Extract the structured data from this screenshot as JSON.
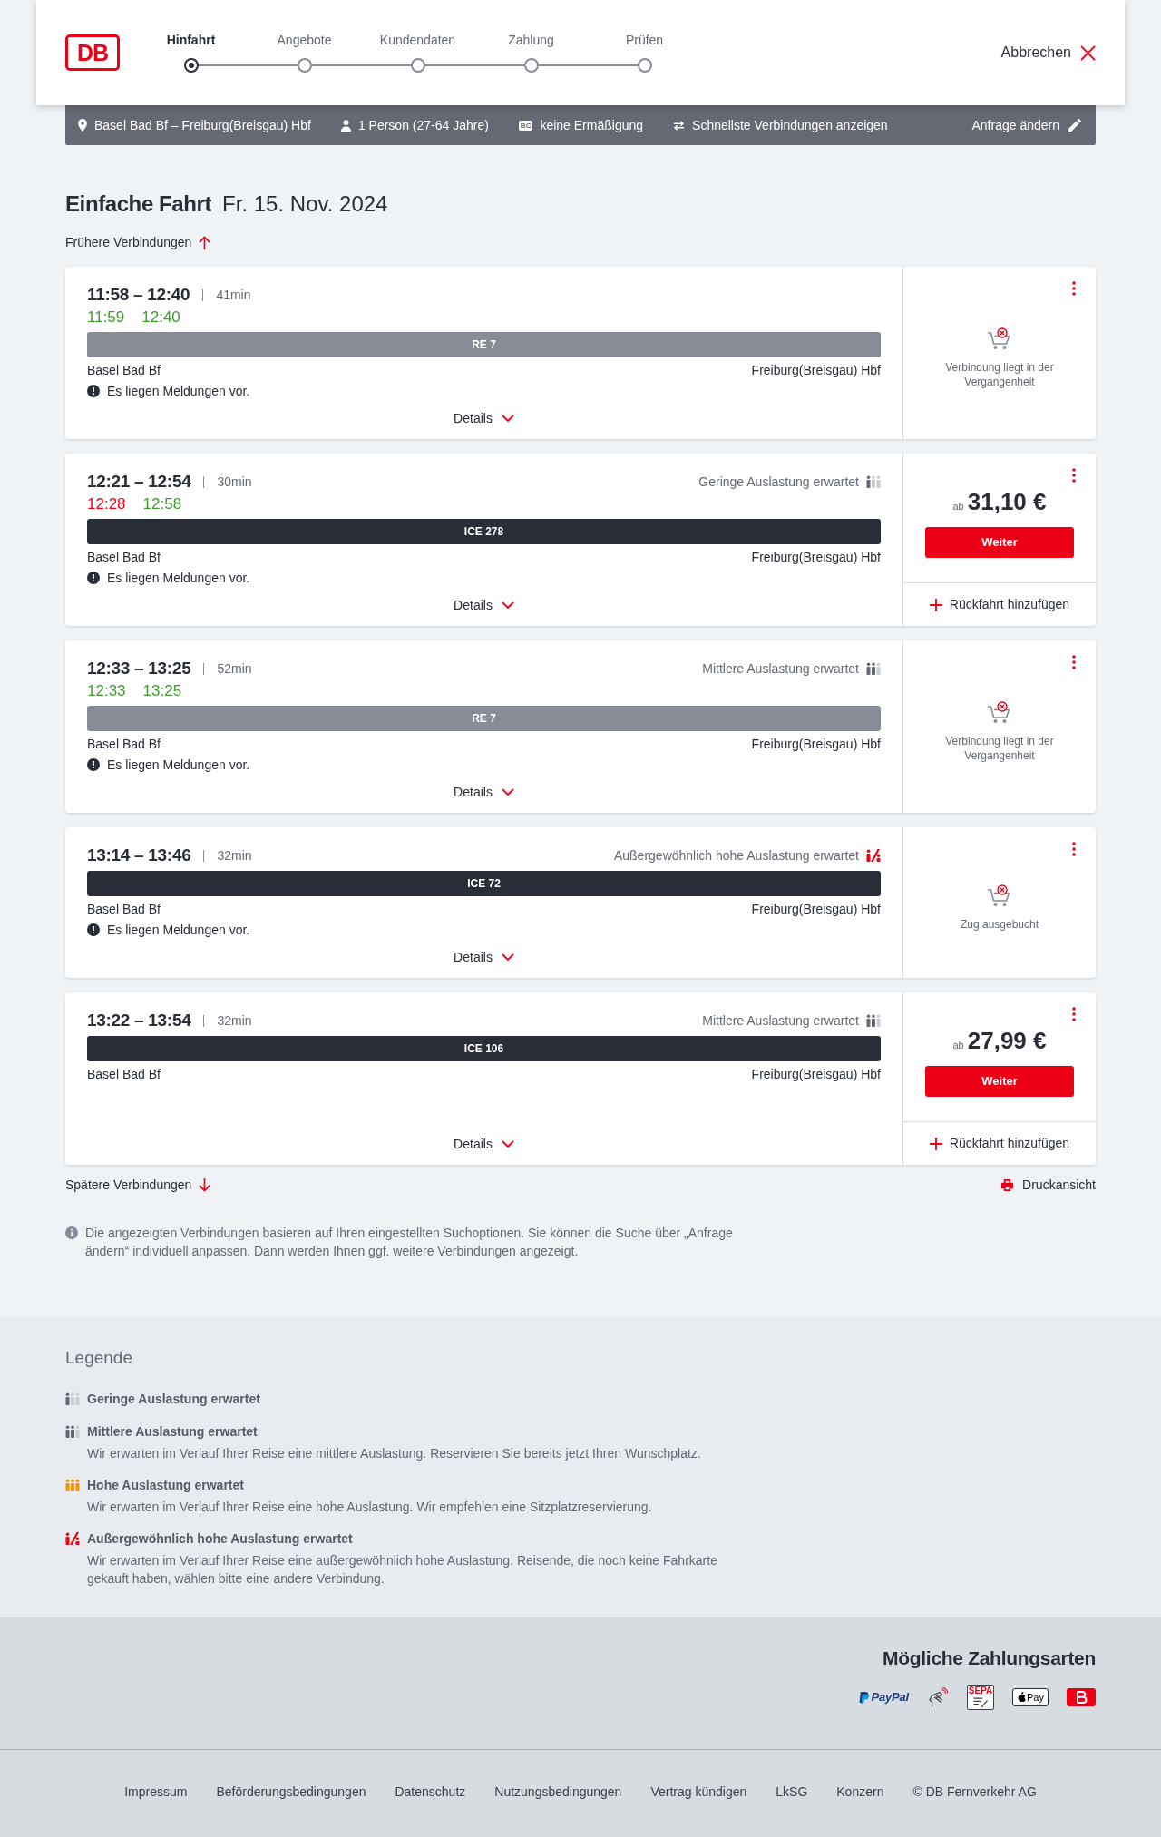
{
  "header": {
    "logo": "DB",
    "steps": [
      {
        "label": "Hinfahrt",
        "selected": true
      },
      {
        "label": "Angebote",
        "selected": false
      },
      {
        "label": "Kundendaten",
        "selected": false
      },
      {
        "label": "Zahlung",
        "selected": false
      },
      {
        "label": "Prüfen",
        "selected": false
      }
    ],
    "cancel": "Abbrechen"
  },
  "search_summary": {
    "route": "Basel Bad Bf – Freiburg(Breisgau) Hbf",
    "travellers": "1 Person (27-64 Jahre)",
    "card_badge": "BC",
    "discount": "keine Ermäßigung",
    "option": "Schnellste Verbindungen anzeigen",
    "edit": "Anfrage ändern"
  },
  "heading": {
    "trip_type": "Einfache Fahrt",
    "date": "Fr. 15. Nov. 2024"
  },
  "earlier": "Frühere Verbindungen",
  "connections": [
    {
      "times": "11:58 – 12:40",
      "duration": "41min",
      "realtime": [
        {
          "time": "11:59",
          "delayed": false
        },
        {
          "time": "12:40",
          "delayed": false
        }
      ],
      "train": {
        "name": "RE 7",
        "kind": "regional"
      },
      "from": "Basel Bad Bf",
      "to": "Freiburg(Breisgau) Hbf",
      "notice": "Es liegen Meldungen vor.",
      "details": "Details",
      "offer": {
        "kind": "unavailable",
        "message": "Verbindung liegt in der Vergangenheit"
      }
    },
    {
      "times": "12:21 – 12:54",
      "duration": "30min",
      "occupancy": {
        "kind": "low",
        "label": "Geringe Auslastung erwartet"
      },
      "realtime": [
        {
          "time": "12:28",
          "delayed": true
        },
        {
          "time": "12:58",
          "delayed": false
        }
      ],
      "train": {
        "name": "ICE 278",
        "kind": "intercity"
      },
      "from": "Basel Bad Bf",
      "to": "Freiburg(Breisgau) Hbf",
      "notice": "Es liegen Meldungen vor.",
      "details": "Details",
      "offer": {
        "kind": "price",
        "prefix": "ab",
        "price": "31,10 €",
        "button": "Weiter",
        "return_trip": "Rückfahrt hinzufügen"
      }
    },
    {
      "times": "12:33 – 13:25",
      "duration": "52min",
      "occupancy": {
        "kind": "medium",
        "label": "Mittlere Auslastung erwartet"
      },
      "realtime": [
        {
          "time": "12:33",
          "delayed": false
        },
        {
          "time": "13:25",
          "delayed": false
        }
      ],
      "train": {
        "name": "RE 7",
        "kind": "regional"
      },
      "from": "Basel Bad Bf",
      "to": "Freiburg(Breisgau) Hbf",
      "notice": "Es liegen Meldungen vor.",
      "details": "Details",
      "offer": {
        "kind": "unavailable",
        "message": "Verbindung liegt in der Vergangenheit"
      }
    },
    {
      "times": "13:14 – 13:46",
      "duration": "32min",
      "occupancy": {
        "kind": "exceptional",
        "label": "Außergewöhnlich hohe Auslastung erwartet"
      },
      "train": {
        "name": "ICE 72",
        "kind": "intercity"
      },
      "from": "Basel Bad Bf",
      "to": "Freiburg(Breisgau) Hbf",
      "notice": "Es liegen Meldungen vor.",
      "details": "Details",
      "offer": {
        "kind": "unavailable",
        "message": "Zug ausgebucht"
      }
    },
    {
      "times": "13:22 – 13:54",
      "duration": "32min",
      "occupancy": {
        "kind": "medium",
        "label": "Mittlere Auslastung erwartet"
      },
      "train": {
        "name": "ICE 106",
        "kind": "intercity"
      },
      "from": "Basel Bad Bf",
      "to": "Freiburg(Breisgau) Hbf",
      "details": "Details",
      "offer": {
        "kind": "price",
        "prefix": "ab",
        "price": "27,99 €",
        "button": "Weiter",
        "return_trip": "Rückfahrt hinzufügen"
      }
    }
  ],
  "later": "Spätere Verbindungen",
  "print": "Druckansicht",
  "note": "Die angezeigten Verbindungen basieren auf Ihren eingestellten Suchoptionen. Sie können die Suche über „Anfrage ändern“ individuell anpassen. Dann werden Ihnen ggf. weitere Verbindungen angezeigt.",
  "legend": {
    "title": "Legende",
    "items": [
      {
        "kind": "low",
        "title": "Geringe Auslastung erwartet"
      },
      {
        "kind": "medium",
        "title": "Mittlere Auslastung erwartet",
        "description": "Wir erwarten im Verlauf Ihrer Reise eine mittlere Auslastung. Reservieren Sie bereits jetzt Ihren Wunschplatz."
      },
      {
        "kind": "high",
        "title": "Hohe Auslastung erwartet",
        "description": "Wir erwarten im Verlauf Ihrer Reise eine hohe Auslastung. Wir empfehlen eine Sitzplatzreservierung."
      },
      {
        "kind": "exceptional",
        "title": "Außergewöhnlich hohe Auslastung erwartet",
        "description": "Wir erwarten im Verlauf Ihrer Reise eine außergewöhnlich hohe Auslastung. Reisende, die noch keine Fahrkarte gekauft haben, wählen bitte eine andere Verbindung."
      }
    ]
  },
  "payment": {
    "title": "Mögliche Zahlungsarten",
    "methods": [
      {
        "kind": "paypal",
        "label": "PayPal"
      },
      {
        "kind": "contactless"
      },
      {
        "kind": "sepa",
        "label": "SEPA"
      },
      {
        "kind": "applepay",
        "label": "Pay"
      },
      {
        "kind": "bonus"
      }
    ]
  },
  "footer": {
    "links": [
      "Impressum",
      "Beförderungsbedingungen",
      "Datenschutz",
      "Nutzungsbedingungen",
      "Vertrag kündigen",
      "LkSG",
      "Konzern"
    ],
    "copyright": "© DB Fernverkehr AG"
  }
}
